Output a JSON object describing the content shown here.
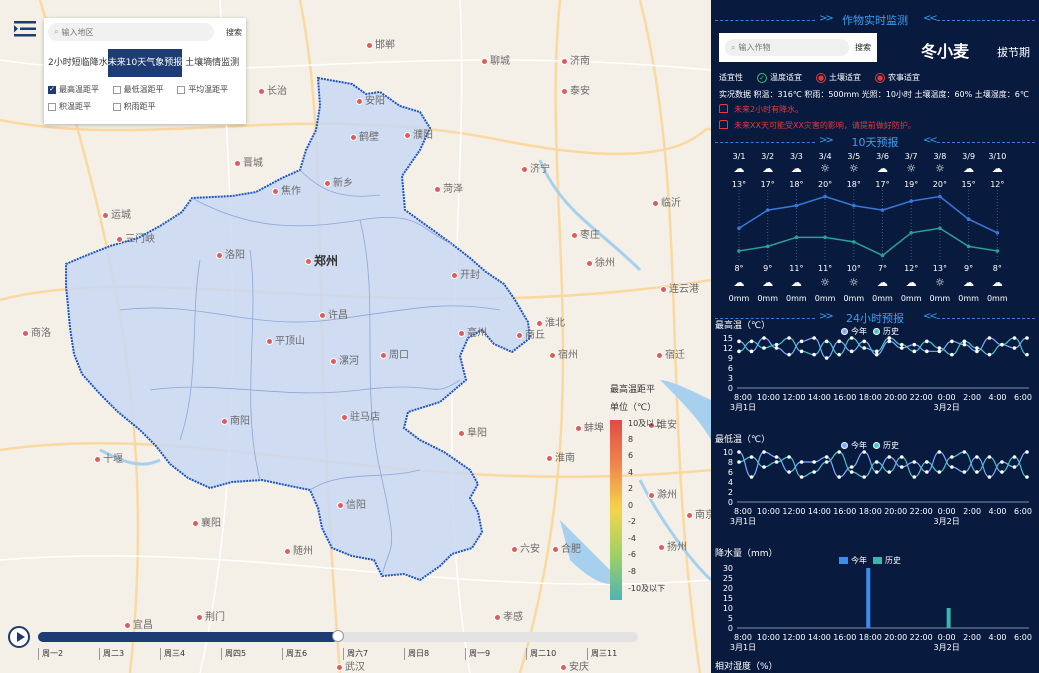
{
  "map": {
    "search": {
      "placeholder": "输入地区",
      "button": "搜索"
    },
    "tabs": [
      {
        "label": "2小时短临降水",
        "active": false
      },
      {
        "label": "未来10天气象预报",
        "active": true
      },
      {
        "label": "土壤墒情监测",
        "active": false
      }
    ],
    "checks": [
      {
        "label": "最高温距平",
        "checked": true
      },
      {
        "label": "最低温距平",
        "checked": false
      },
      {
        "label": "平均温距平",
        "checked": false
      },
      {
        "label": "积温距平",
        "checked": false
      },
      {
        "label": "积雨距平",
        "checked": false
      }
    ],
    "cities": [
      {
        "name": "郑州",
        "big": true
      },
      {
        "name": "开封"
      },
      {
        "name": "洛阳"
      },
      {
        "name": "新乡"
      },
      {
        "name": "焦作"
      },
      {
        "name": "鹤壁"
      },
      {
        "name": "安阳"
      },
      {
        "name": "濮阳"
      },
      {
        "name": "许昌"
      },
      {
        "name": "平顶山"
      },
      {
        "name": "漯河"
      },
      {
        "name": "周口"
      },
      {
        "name": "商丘"
      },
      {
        "name": "驻马店"
      },
      {
        "name": "南阳"
      },
      {
        "name": "信阳"
      },
      {
        "name": "三门峡"
      },
      {
        "name": "济南"
      },
      {
        "name": "邯郸"
      },
      {
        "name": "长治"
      },
      {
        "name": "晋城"
      },
      {
        "name": "运城"
      },
      {
        "name": "亳州"
      },
      {
        "name": "阜阳"
      },
      {
        "name": "合肥"
      },
      {
        "name": "南京"
      },
      {
        "name": "襄阳"
      },
      {
        "name": "随州"
      },
      {
        "name": "十堰"
      },
      {
        "name": "六安"
      },
      {
        "name": "菏泽"
      },
      {
        "name": "济宁"
      },
      {
        "name": "聊城"
      },
      {
        "name": "泰安"
      },
      {
        "name": "淮北"
      },
      {
        "name": "宿州"
      },
      {
        "name": "临沂"
      },
      {
        "name": "枣庄"
      },
      {
        "name": "徐州"
      },
      {
        "name": "蚌埠"
      },
      {
        "name": "淮南"
      },
      {
        "name": "滁州"
      },
      {
        "name": "荆门"
      },
      {
        "name": "商洛"
      },
      {
        "name": "武汉"
      },
      {
        "name": "安庆"
      },
      {
        "name": "宜昌"
      },
      {
        "name": "孝感"
      },
      {
        "name": "宿迁"
      },
      {
        "name": "连云港"
      },
      {
        "name": "淮安"
      },
      {
        "name": "扬州"
      }
    ],
    "legend": {
      "title": "最高温距平",
      "unit": "单位（℃）",
      "ticks": [
        "10及以上",
        "8",
        "6",
        "4",
        "2",
        "0",
        "-2",
        "-4",
        "-6",
        "-8",
        "-10及以下"
      ]
    },
    "timeline": {
      "days": [
        "周一2",
        "周二3",
        "周三4",
        "周四5",
        "周五6",
        "周六7",
        "周日8",
        "周一9",
        "周二10",
        "周三11"
      ],
      "progress": 0.5
    }
  },
  "panel": {
    "title1": "作物实时监测",
    "crop_search": {
      "placeholder": "输入作物",
      "button": "搜索"
    },
    "crop_name": "冬小麦",
    "stage": "拔节期",
    "suit_label": "适宜性",
    "suits": [
      {
        "label": "温度适宜",
        "color": "#38c172",
        "sym": "✓"
      },
      {
        "label": "土壤适宜",
        "color": "#e2393c",
        "sym": "●"
      },
      {
        "label": "农事适宜",
        "color": "#e2393c",
        "sym": "●"
      }
    ],
    "realtime": "实况数据   积温：316℃   积雨：500mm   光照：10小时   土壤温度：60%   土壤湿度：6℃",
    "alerts": [
      "未来2小时有降水。",
      "未来XX天可能受XX灾害的影响，请提前做好防护。"
    ],
    "title2": "10天预报",
    "forecast": {
      "dates": [
        "3/1",
        "3/2",
        "3/3",
        "3/4",
        "3/5",
        "3/6",
        "3/7",
        "3/8",
        "3/9",
        "3/10"
      ],
      "day_icons": [
        "cloud",
        "cloud",
        "cloud",
        "sun",
        "sun",
        "cloud",
        "sun",
        "sun",
        "cloud",
        "cloud"
      ],
      "highs": [
        13,
        17,
        18,
        20,
        18,
        17,
        19,
        20,
        15,
        12
      ],
      "lows": [
        8,
        9,
        11,
        11,
        10,
        7,
        12,
        13,
        9,
        8
      ],
      "high_labels": [
        "13°",
        "17°",
        "18°",
        "20°",
        "18°",
        "17°",
        "19°",
        "20°",
        "15°",
        "12°"
      ],
      "low_labels": [
        "8°",
        "9°",
        "11°",
        "11°",
        "10°",
        "7°",
        "12°",
        "13°",
        "9°",
        "8°"
      ],
      "night_icons": [
        "cloud",
        "cloud",
        "cloud",
        "sun",
        "sun",
        "cloud",
        "cloud",
        "sun",
        "cloud",
        "cloud"
      ],
      "rain": [
        "0mm",
        "0mm",
        "0mm",
        "0mm",
        "0mm",
        "0mm",
        "0mm",
        "0mm",
        "0mm",
        "0mm"
      ],
      "colors": {
        "high": "#3a78d8",
        "low": "#2aa198"
      }
    },
    "title3": "24小时预报",
    "chart_data": [
      {
        "type": "line",
        "title": "最高温（℃）",
        "x": [
          "8:00",
          "10:00",
          "12:00",
          "14:00",
          "16:00",
          "18:00",
          "20:00",
          "22:00",
          "0:00",
          "2:00",
          "4:00",
          "6:00"
        ],
        "x_sub": {
          "8:00": "3月1日",
          "0:00": "3月2日"
        },
        "ylim": [
          0,
          15
        ],
        "yticks": [
          0,
          3,
          6,
          9,
          12,
          15
        ],
        "series": [
          {
            "name": "今年",
            "color": "#7fa8ff",
            "values": [
              14,
              11,
              15,
              12,
              10,
              14,
              15,
              9,
              14,
              11,
              14,
              10,
              14,
              12,
              13,
              11,
              11,
              14,
              13,
              11,
              15,
              13,
              12,
              15
            ]
          },
          {
            "name": "历史",
            "color": "#4cc4c4",
            "values": [
              11,
              14,
              12,
              13,
              15,
              11,
              10,
              14,
              10,
              15,
              12,
              11,
              15,
              13,
              11,
              14,
              12,
              10,
              14,
              12,
              10,
              13,
              15,
              10
            ]
          }
        ]
      },
      {
        "type": "line",
        "title": "最低温（℃）",
        "x": [
          "8:00",
          "10:00",
          "12:00",
          "14:00",
          "16:00",
          "18:00",
          "20:00",
          "22:00",
          "0:00",
          "2:00",
          "4:00",
          "6:00"
        ],
        "x_sub": {
          "8:00": "3月1日",
          "0:00": "3月2日"
        },
        "ylim": [
          0,
          10
        ],
        "yticks": [
          0,
          2,
          4,
          6,
          8,
          10
        ],
        "series": [
          {
            "name": "今年",
            "color": "#7fa8ff",
            "values": [
              10,
              5,
              10,
              9,
              6,
              8,
              8,
              9,
              5,
              7,
              10,
              6,
              9,
              7,
              8,
              6,
              10,
              7,
              6,
              9,
              5,
              8,
              7,
              10
            ]
          },
          {
            "name": "历史",
            "color": "#4cc4c4",
            "values": [
              8,
              9,
              7,
              8,
              9,
              5,
              6,
              8,
              10,
              6,
              5,
              8,
              6,
              9,
              5,
              8,
              6,
              9,
              10,
              6,
              9,
              6,
              9,
              5
            ]
          }
        ]
      },
      {
        "type": "bar",
        "title": "降水量（mm）",
        "x": [
          "8:00",
          "10:00",
          "12:00",
          "14:00",
          "16:00",
          "18:00",
          "20:00",
          "22:00",
          "0:00",
          "2:00",
          "4:00",
          "6:00"
        ],
        "x_sub": {
          "8:00": "3月1日",
          "0:00": "3月2日"
        },
        "ylim": [
          0,
          30
        ],
        "yticks": [
          0,
          5,
          10,
          15,
          20,
          25,
          30
        ],
        "series": [
          {
            "name": "今年",
            "color": "#3a8ef0",
            "values": [
              0,
              0,
              0,
              0,
              0,
              30,
              0,
              0,
              0,
              0,
              0,
              0
            ]
          },
          {
            "name": "历史",
            "color": "#36b8b0",
            "values": [
              0,
              0,
              0,
              0,
              0,
              0,
              0,
              0,
              10,
              0,
              0,
              0
            ]
          }
        ]
      }
    ],
    "humidity_label": "相对湿度（%）"
  }
}
